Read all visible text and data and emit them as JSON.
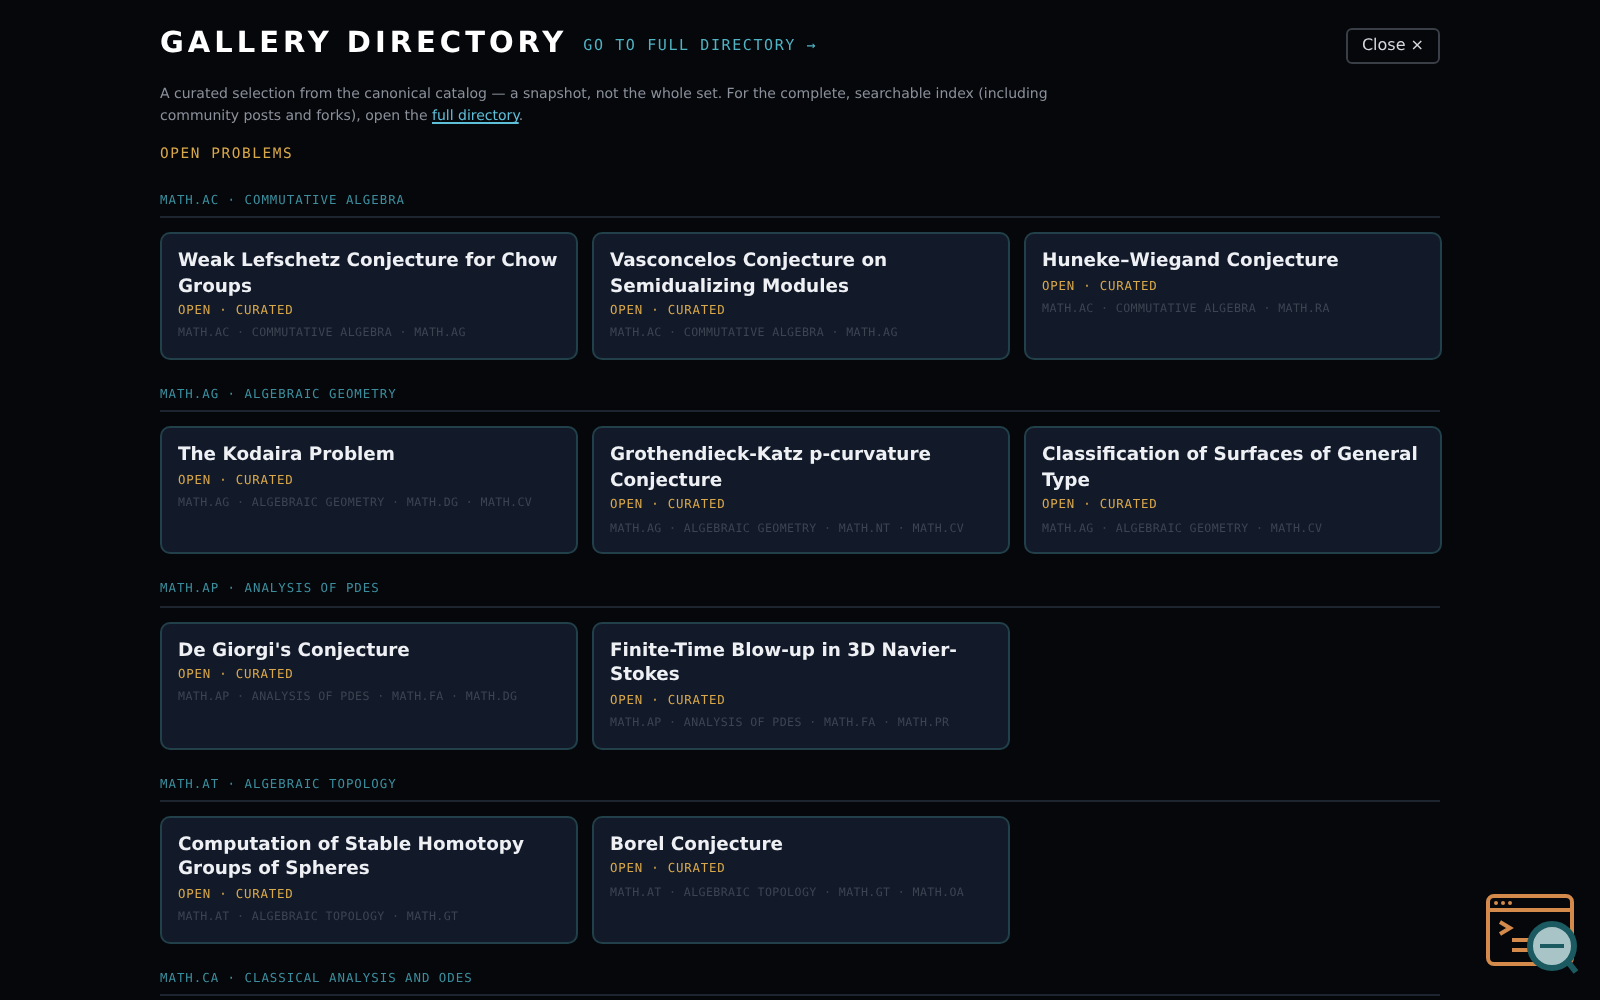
{
  "modal": {
    "title": "GALLERY DIRECTORY",
    "directory_link": "GO TO FULL DIRECTORY →",
    "close_button": "Close ×",
    "description": "A curated selection from the canonical catalog — a snapshot, not the whole set. For the complete, searchable index (including community posts and forks), open the ",
    "description_link": "full directory",
    "description_end": ".",
    "group_label": "OPEN PROBLEMS",
    "sections": [
      {
        "heading": "MATH.AC · COMMUTATIVE ALGEBRA",
        "cards": [
          {
            "title": "Weak Lefschetz Conjecture for Chow Groups",
            "status": "OPEN · CURATED",
            "tags": "MATH.AC · COMMUTATIVE ALGEBRA · MATH.AG"
          },
          {
            "title": "Vasconcelos Conjecture on Semidualizing Modules",
            "status": "OPEN · CURATED",
            "tags": "MATH.AC · COMMUTATIVE ALGEBRA · MATH.AG"
          },
          {
            "title": "Huneke–Wiegand Conjecture",
            "status": "OPEN · CURATED",
            "tags": "MATH.AC · COMMUTATIVE ALGEBRA · MATH.RA"
          }
        ]
      },
      {
        "heading": "MATH.AG · ALGEBRAIC GEOMETRY",
        "cards": [
          {
            "title": "The Kodaira Problem",
            "status": "OPEN · CURATED",
            "tags": "MATH.AG · ALGEBRAIC GEOMETRY · MATH.DG · MATH.CV"
          },
          {
            "title": "Grothendieck-Katz p-curvature Conjecture",
            "status": "OPEN · CURATED",
            "tags": "MATH.AG · ALGEBRAIC GEOMETRY · MATH.NT · MATH.CV"
          },
          {
            "title": "Classification of Surfaces of General Type",
            "status": "OPEN · CURATED",
            "tags": "MATH.AG · ALGEBRAIC GEOMETRY · MATH.CV"
          }
        ]
      },
      {
        "heading": "MATH.AP · ANALYSIS OF PDES",
        "cards": [
          {
            "title": "De Giorgi's Conjecture",
            "status": "OPEN · CURATED",
            "tags": "MATH.AP · ANALYSIS OF PDES · MATH.FA · MATH.DG"
          },
          {
            "title": "Finite-Time Blow-up in 3D Navier-Stokes",
            "status": "OPEN · CURATED",
            "tags": "MATH.AP · ANALYSIS OF PDES · MATH.FA · MATH.PR"
          }
        ]
      },
      {
        "heading": "MATH.AT · ALGEBRAIC TOPOLOGY",
        "cards": [
          {
            "title": "Computation of Stable Homotopy Groups of Spheres",
            "status": "OPEN · CURATED",
            "tags": "MATH.AT · ALGEBRAIC TOPOLOGY · MATH.GT"
          },
          {
            "title": "Borel Conjecture",
            "status": "OPEN · CURATED",
            "tags": "MATH.AT · ALGEBRAIC TOPOLOGY · MATH.GT · MATH.OA"
          }
        ]
      },
      {
        "heading": "MATH.CA · CLASSICAL ANALYSIS AND ODES"
      }
    ]
  }
}
